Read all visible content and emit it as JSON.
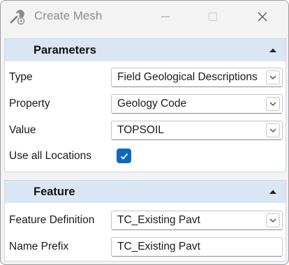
{
  "window": {
    "title": "Create Mesh",
    "icons": [
      "mesh-tool-icon",
      "minimize-icon",
      "maximize-icon",
      "close-icon"
    ]
  },
  "parameters": {
    "header": "Parameters",
    "type_label": "Type",
    "type_value": "Field Geological Descriptions",
    "property_label": "Property",
    "property_value": "Geology Code",
    "value_label": "Value",
    "value_value": "TOPSOIL",
    "use_all_label": "Use all Locations",
    "use_all_checked": true
  },
  "feature": {
    "header": "Feature",
    "definition_label": "Feature Definition",
    "definition_value": "TC_Existing Pavt",
    "name_prefix_label": "Name Prefix",
    "name_prefix_value": "TC_Existing Pavt"
  },
  "colors": {
    "panel_header_bg": "#dbe6f5",
    "checkbox_accent": "#0f67c2",
    "title_text": "#8c8c8c"
  }
}
